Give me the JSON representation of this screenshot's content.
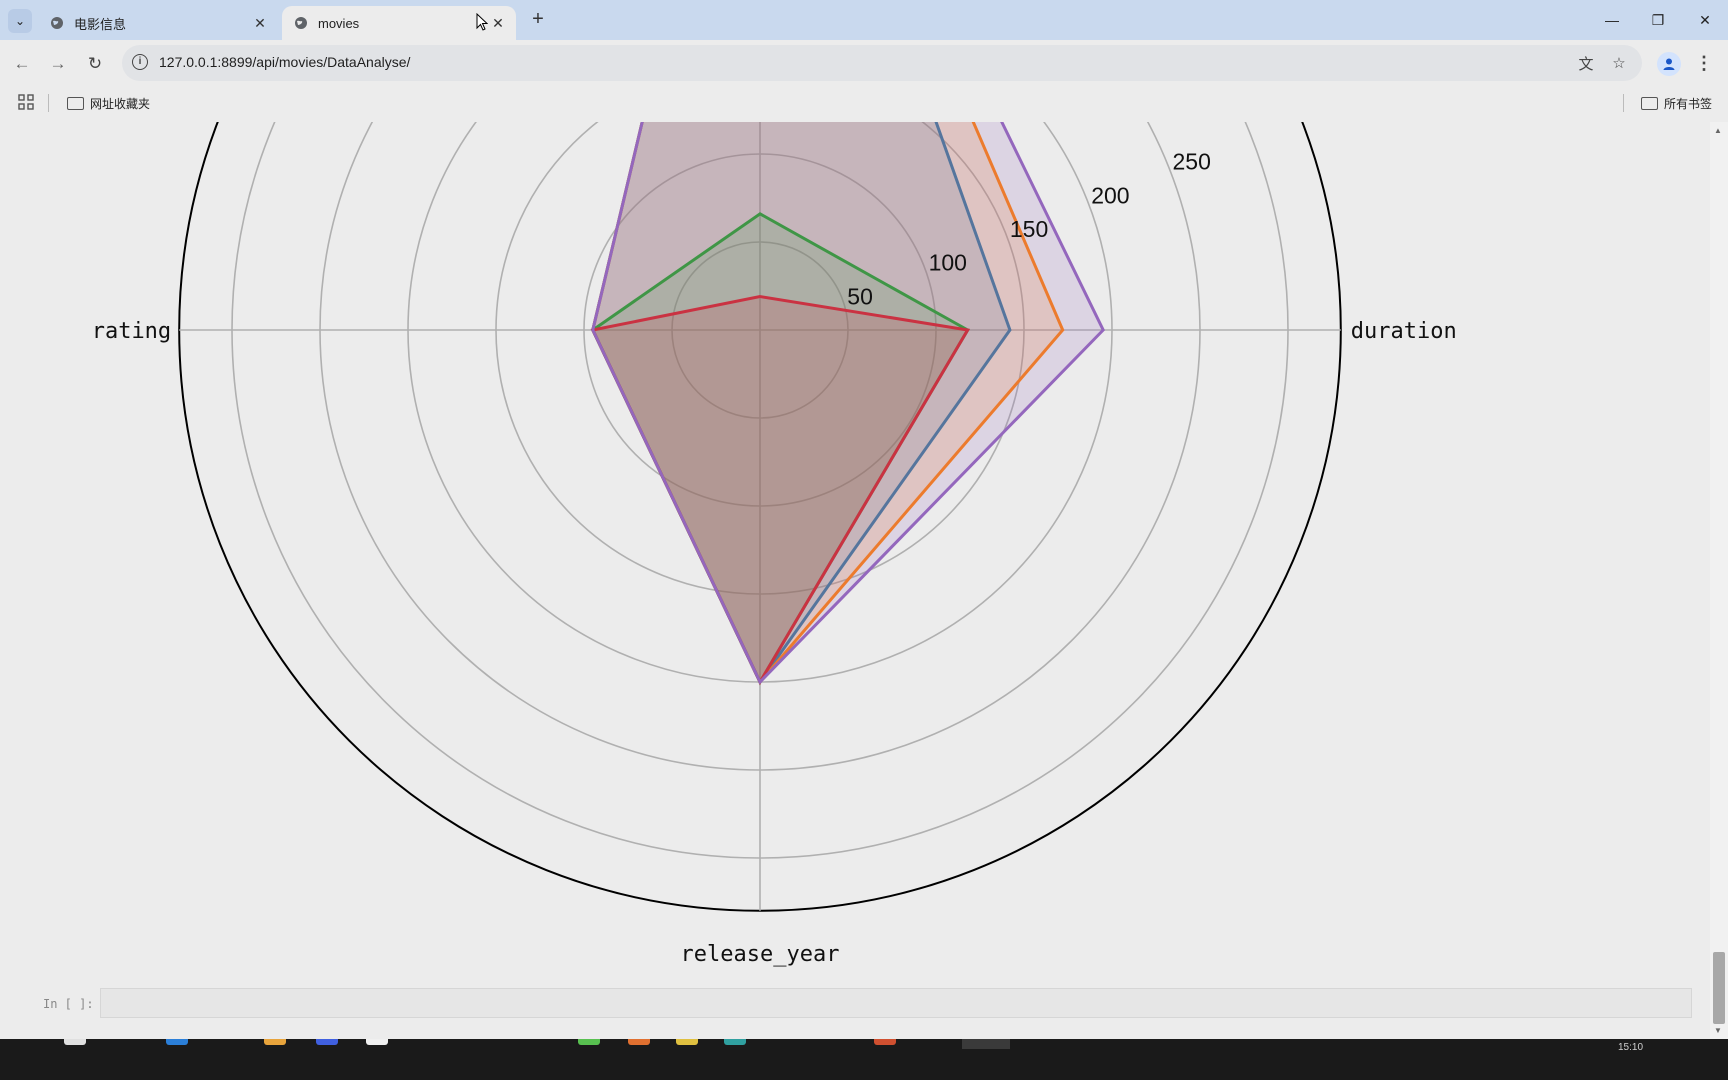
{
  "browser": {
    "tabs": [
      {
        "title": "电影信息",
        "active": false
      },
      {
        "title": "movies",
        "active": true
      }
    ],
    "url": "127.0.0.1:8899/api/movies/DataAnalyse/",
    "bookmarks": {
      "left_folder": "网址收藏夹",
      "right_folder": "所有书签"
    }
  },
  "chart_data": {
    "type": "radar",
    "axes": [
      "duration",
      "release_year",
      "rating"
    ],
    "visible_axis_labels": [
      "rating",
      "duration",
      "release_year"
    ],
    "radial_tick_labels": [
      "50",
      "100",
      "150",
      "200",
      "250"
    ],
    "radial_ticks": [
      50,
      100,
      150,
      200,
      250,
      300
    ],
    "radial_max": 330,
    "grid": true,
    "series": [
      {
        "color": "#1f77b4",
        "values": {
          "duration": 142,
          "release_year": 200,
          "rating": 95
        }
      },
      {
        "color": "#ff7f0e",
        "values": {
          "duration": 172,
          "release_year": 200,
          "rating": 95
        }
      },
      {
        "color": "#2ca02c",
        "values": {
          "duration": 118,
          "release_year": 200,
          "rating": 95,
          "top": 66
        }
      },
      {
        "color": "#d62728",
        "values": {
          "duration": 118,
          "release_year": 200,
          "rating": 95,
          "top": 19
        }
      },
      {
        "color": "#9467bd",
        "values": {
          "duration": 195,
          "release_year": 200,
          "rating": 95
        }
      }
    ]
  },
  "notebook": {
    "prompt": "In [ ]:"
  },
  "taskbar": {
    "clock": "15:10"
  }
}
